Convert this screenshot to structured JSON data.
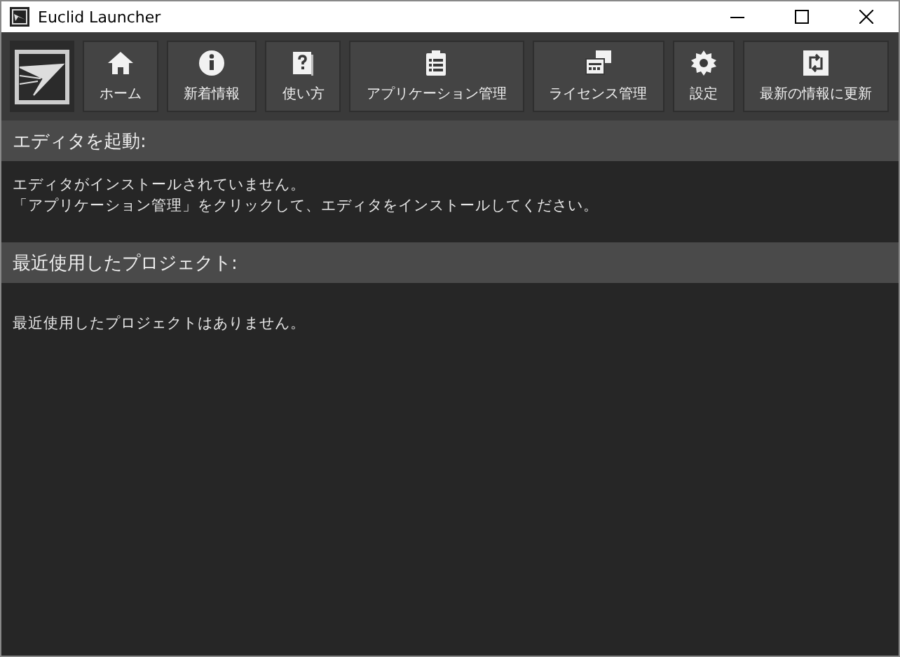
{
  "window": {
    "title": "Euclid Launcher"
  },
  "toolbar": [
    {
      "kind": "home",
      "label": "ホーム"
    },
    {
      "kind": "info",
      "label": "新着情報"
    },
    {
      "kind": "help",
      "label": "使い方"
    },
    {
      "kind": "apps",
      "label": "アプリケーション管理"
    },
    {
      "kind": "license",
      "label": "ライセンス管理"
    },
    {
      "kind": "settings",
      "label": "設定"
    },
    {
      "kind": "refresh",
      "label": "最新の情報に更新"
    }
  ],
  "sections": [
    {
      "title": "エディタを起動:",
      "lines": [
        "エディタがインストールされていません。",
        "「アプリケーション管理」をクリックして、エディタをインストールしてください。"
      ]
    },
    {
      "title": "最近使用したプロジェクト:",
      "lines": [
        "最近使用したプロジェクトはありません。"
      ]
    }
  ]
}
